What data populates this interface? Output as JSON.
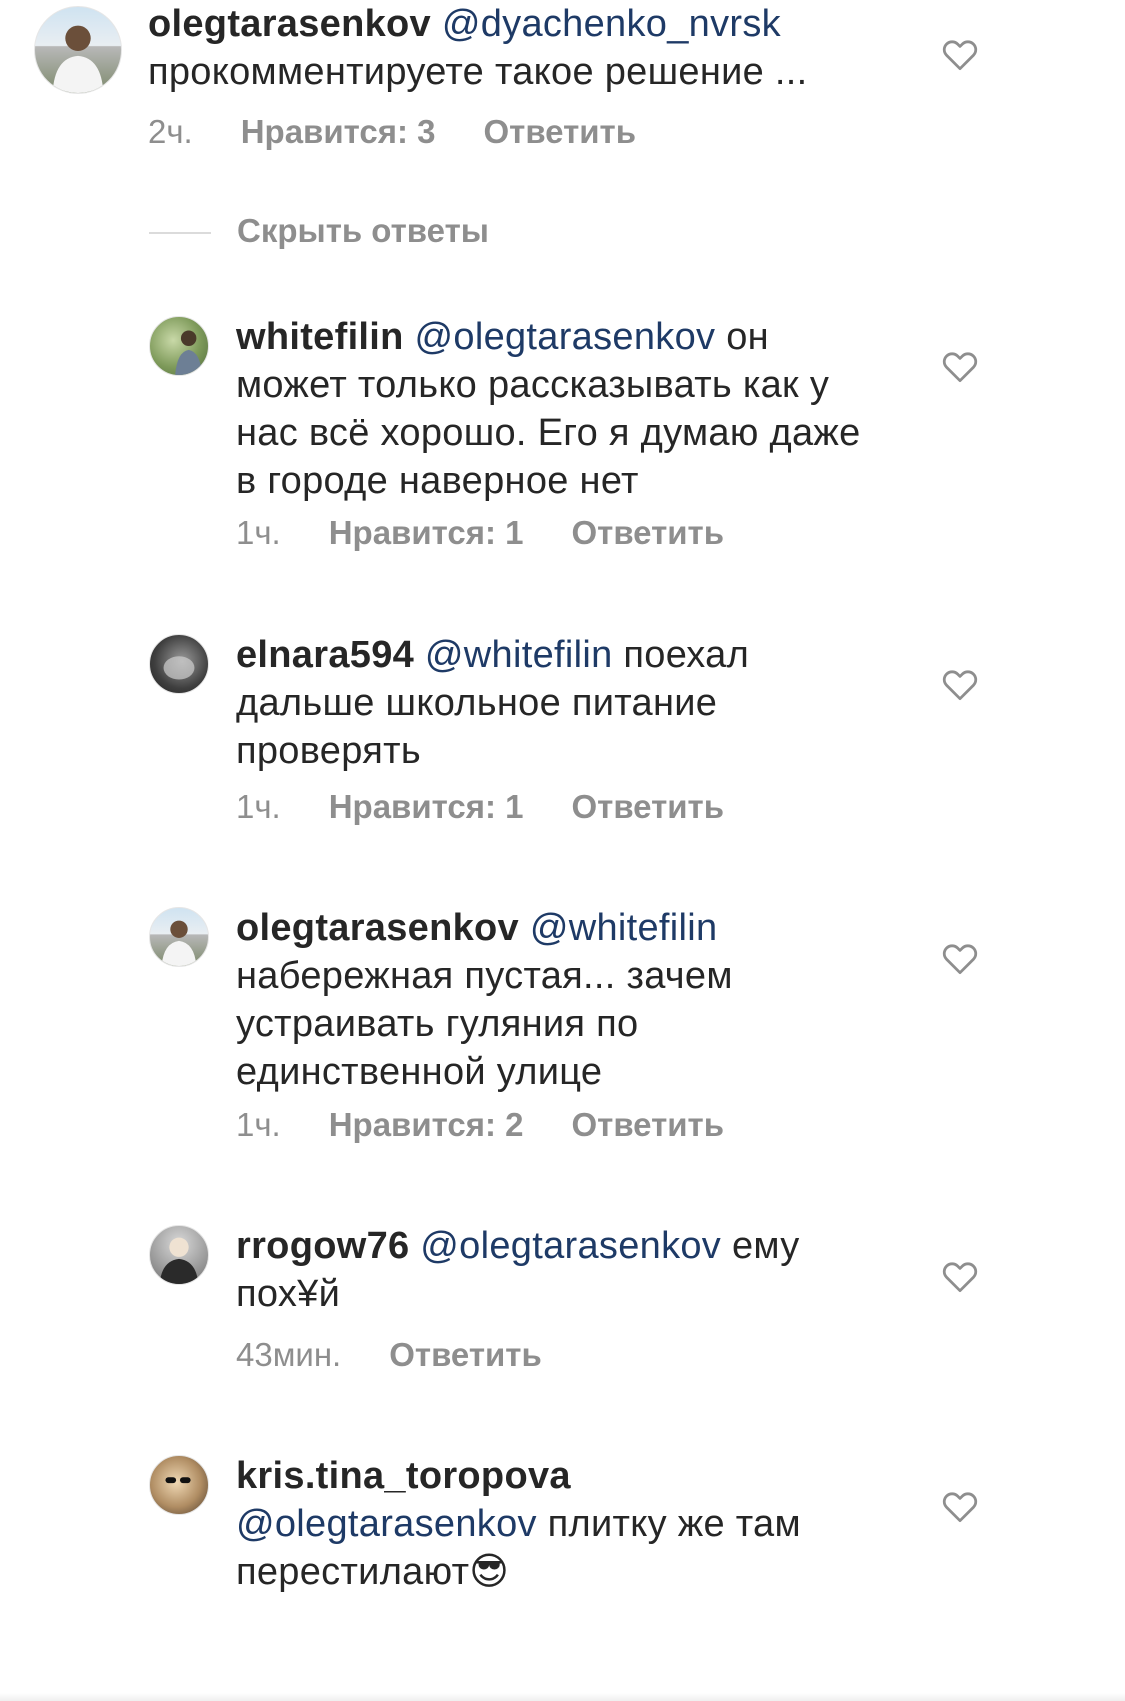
{
  "comments": [
    {
      "username": "olegtarasenkov",
      "mention": "@dyachenko_nvrsk",
      "text": "прокомментируете такое решение ...",
      "time": "2ч.",
      "likes": "Нравится: 3",
      "reply": "Ответить",
      "avatar_icon": "user-avatar-man-white-shirt"
    },
    {
      "username": "whitefilin",
      "mention": "@olegtarasenkov",
      "text": "он может только рассказывать как у нас всё хорошо. Его я думаю даже в городе наверное нет",
      "time": "1ч.",
      "likes": "Нравится: 1",
      "reply": "Ответить",
      "avatar_icon": "user-avatar-green"
    },
    {
      "username": "elnara594",
      "mention": "@whitefilin",
      "text": "поехал дальше школьное питание проверять",
      "time": "1ч.",
      "likes": "Нравится: 1",
      "reply": "Ответить",
      "avatar_icon": "user-avatar-dark"
    },
    {
      "username": "olegtarasenkov",
      "mention": "@whitefilin",
      "text": "набережная пустая... зачем устраивать гуляния по единственной улице",
      "time": "1ч.",
      "likes": "Нравится: 2",
      "reply": "Ответить",
      "avatar_icon": "user-avatar-man-white-shirt"
    },
    {
      "username": "rrogow76",
      "mention": "@olegtarasenkov",
      "text": "ему пох¥й",
      "time": "43мин.",
      "likes": "",
      "reply": "Ответить",
      "avatar_icon": "user-avatar-man-dark-shirt"
    },
    {
      "username": "kris.tina_toropova",
      "mention": "@olegtarasenkov",
      "text": "плитку же там перестилают😎",
      "time": "",
      "likes": "",
      "reply": "",
      "avatar_icon": "user-avatar-woman-sunglasses"
    }
  ],
  "hide_replies_label": "Скрыть ответы",
  "icons": {
    "like": "heart-outline-icon"
  },
  "colors": {
    "mention": "#1e3a66",
    "meta": "#8e8e8e",
    "text": "#262626"
  }
}
